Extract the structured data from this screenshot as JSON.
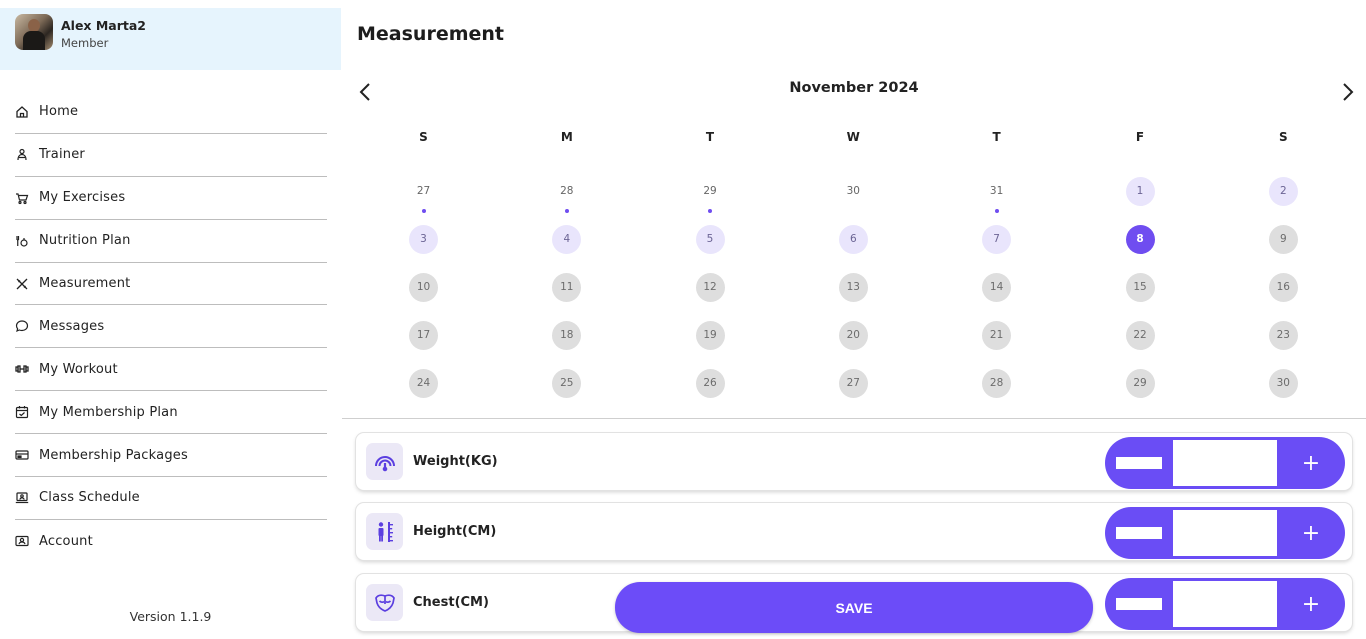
{
  "profile": {
    "name": "Alex Marta2",
    "role": "Member"
  },
  "sidebar": {
    "items": [
      {
        "label": "Home",
        "icon": "home-icon"
      },
      {
        "label": "Trainer",
        "icon": "trainer-icon"
      },
      {
        "label": "My Exercises",
        "icon": "exercises-icon"
      },
      {
        "label": "Nutrition Plan",
        "icon": "nutrition-icon"
      },
      {
        "label": "Measurement",
        "icon": "measurement-icon"
      },
      {
        "label": "Messages",
        "icon": "chat-icon"
      },
      {
        "label": "My Workout",
        "icon": "dumbbell-icon"
      },
      {
        "label": "My Membership Plan",
        "icon": "calendar-check-icon"
      },
      {
        "label": "Membership Packages",
        "icon": "card-icon"
      },
      {
        "label": "Class Schedule",
        "icon": "laptop-user-icon"
      },
      {
        "label": "Account",
        "icon": "account-icon"
      }
    ],
    "version": "Version 1.1.9"
  },
  "page": {
    "title": "Measurement"
  },
  "calendar": {
    "month_label": "November 2024",
    "weekdays": [
      "S",
      "M",
      "T",
      "W",
      "T",
      "F",
      "S"
    ],
    "weeks": [
      [
        {
          "day": "27",
          "state": "other",
          "dot": true
        },
        {
          "day": "28",
          "state": "other",
          "dot": true
        },
        {
          "day": "29",
          "state": "other",
          "dot": true
        },
        {
          "day": "30",
          "state": "other",
          "dot": false
        },
        {
          "day": "31",
          "state": "other",
          "dot": true
        },
        {
          "day": "1",
          "state": "light",
          "dot": false
        },
        {
          "day": "2",
          "state": "light",
          "dot": false
        }
      ],
      [
        {
          "day": "3",
          "state": "light",
          "dot": false
        },
        {
          "day": "4",
          "state": "light",
          "dot": false
        },
        {
          "day": "5",
          "state": "light",
          "dot": false
        },
        {
          "day": "6",
          "state": "light",
          "dot": false
        },
        {
          "day": "7",
          "state": "light",
          "dot": false
        },
        {
          "day": "8",
          "state": "selected",
          "dot": false
        },
        {
          "day": "9",
          "state": "gray",
          "dot": false
        }
      ],
      [
        {
          "day": "10",
          "state": "gray",
          "dot": false
        },
        {
          "day": "11",
          "state": "gray",
          "dot": false
        },
        {
          "day": "12",
          "state": "gray",
          "dot": false
        },
        {
          "day": "13",
          "state": "gray",
          "dot": false
        },
        {
          "day": "14",
          "state": "gray",
          "dot": false
        },
        {
          "day": "15",
          "state": "gray",
          "dot": false
        },
        {
          "day": "16",
          "state": "gray",
          "dot": false
        }
      ],
      [
        {
          "day": "17",
          "state": "gray",
          "dot": false
        },
        {
          "day": "18",
          "state": "gray",
          "dot": false
        },
        {
          "day": "19",
          "state": "gray",
          "dot": false
        },
        {
          "day": "20",
          "state": "gray",
          "dot": false
        },
        {
          "day": "21",
          "state": "gray",
          "dot": false
        },
        {
          "day": "22",
          "state": "gray",
          "dot": false
        },
        {
          "day": "23",
          "state": "gray",
          "dot": false
        }
      ],
      [
        {
          "day": "24",
          "state": "gray",
          "dot": false
        },
        {
          "day": "25",
          "state": "gray",
          "dot": false
        },
        {
          "day": "26",
          "state": "gray",
          "dot": false
        },
        {
          "day": "27",
          "state": "gray",
          "dot": false
        },
        {
          "day": "28",
          "state": "gray",
          "dot": false
        },
        {
          "day": "29",
          "state": "gray",
          "dot": false
        },
        {
          "day": "30",
          "state": "gray",
          "dot": false
        }
      ]
    ]
  },
  "measurements": [
    {
      "label": "Weight(KG)",
      "icon": "weight-gauge-icon",
      "value": "",
      "plus": "+"
    },
    {
      "label": "Height(CM)",
      "icon": "height-ruler-icon",
      "value": "",
      "plus": "+"
    },
    {
      "label": "Chest(CM)",
      "icon": "chest-icon",
      "value": "",
      "plus": "+"
    }
  ],
  "save_label": "SAVE",
  "colors": {
    "accent": "#6c4cf8",
    "profile_bg": "#e6f4fd",
    "light_day": "#e9e5fc",
    "gray_day": "#dedede"
  }
}
